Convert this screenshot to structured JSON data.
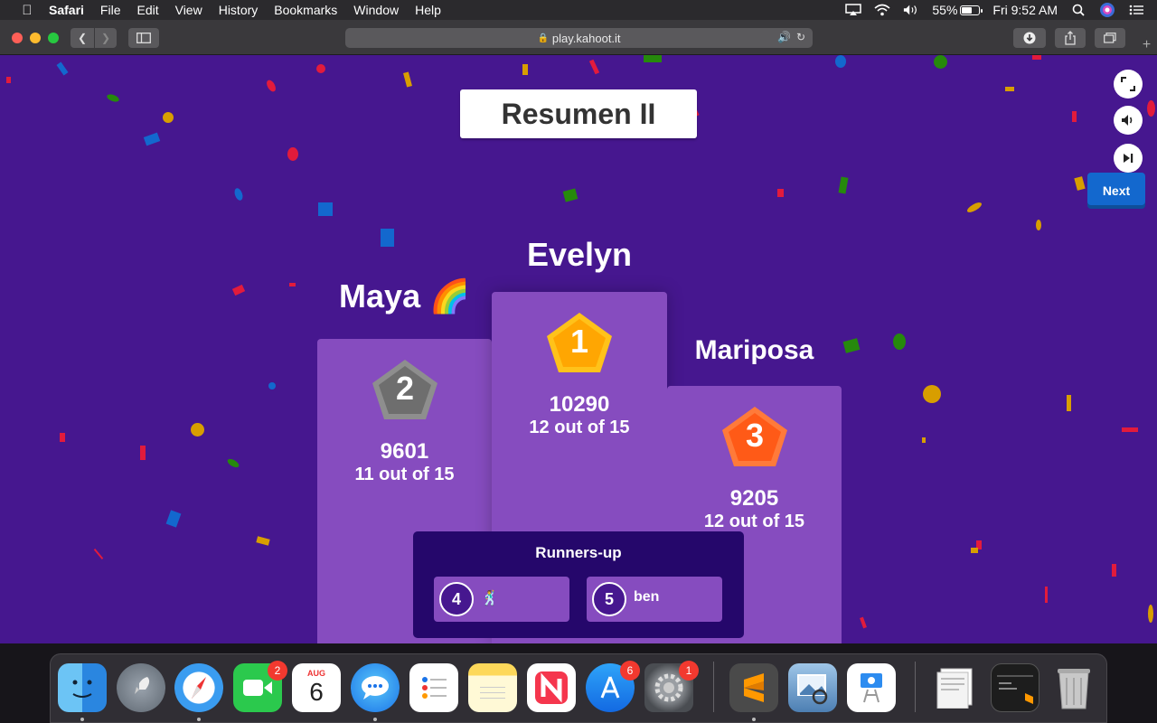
{
  "menubar": {
    "app_name": "Safari",
    "items": [
      "File",
      "Edit",
      "View",
      "History",
      "Bookmarks",
      "Window",
      "Help"
    ],
    "battery_percent": "55%",
    "clock": "Fri 9:52 AM"
  },
  "browser": {
    "url": "play.kahoot.it"
  },
  "quiz": {
    "title": "Resumen II",
    "next_label": "Next",
    "podium": {
      "first": {
        "rank": "1",
        "name": "Evelyn",
        "score": "10290",
        "correct": "12 out of 15"
      },
      "second": {
        "rank": "2",
        "name": "Maya 🌈",
        "score": "9601",
        "correct": "11 out of 15"
      },
      "third": {
        "rank": "3",
        "name": "Mariposa",
        "score": "9205",
        "correct": "12 out of 15"
      }
    },
    "runners_up": {
      "title": "Runners-up",
      "players": [
        {
          "rank": "4",
          "name": "🕺"
        },
        {
          "rank": "5",
          "name": "ben"
        }
      ]
    }
  },
  "dock": {
    "items": [
      {
        "name": "Finder",
        "icon": "finder-icon",
        "badge": ""
      },
      {
        "name": "Launchpad",
        "icon": "rocket-icon",
        "badge": ""
      },
      {
        "name": "Safari",
        "icon": "compass-icon",
        "badge": ""
      },
      {
        "name": "FaceTime",
        "icon": "facetime-icon",
        "badge": "2"
      },
      {
        "name": "Calendar",
        "icon": "calendar-icon",
        "badge": "",
        "month": "AUG",
        "day": "6"
      },
      {
        "name": "Messages",
        "icon": "messages-icon",
        "badge": ""
      },
      {
        "name": "Reminders",
        "icon": "reminders-icon",
        "badge": ""
      },
      {
        "name": "Notes",
        "icon": "notes-icon",
        "badge": ""
      },
      {
        "name": "News",
        "icon": "news-icon",
        "badge": ""
      },
      {
        "name": "App Store",
        "icon": "appstore-icon",
        "badge": "6"
      },
      {
        "name": "System Preferences",
        "icon": "gear-icon",
        "badge": "1"
      },
      {
        "name": "Sublime Text",
        "icon": "sublime-icon",
        "badge": ""
      },
      {
        "name": "Preview",
        "icon": "preview-icon",
        "badge": ""
      },
      {
        "name": "Keynote",
        "icon": "keynote-icon",
        "badge": ""
      },
      {
        "name": "Documents",
        "icon": "documents-icon",
        "badge": ""
      },
      {
        "name": "Terminal",
        "icon": "terminal-icon",
        "badge": ""
      },
      {
        "name": "Trash",
        "icon": "trash-icon",
        "badge": ""
      }
    ]
  },
  "colors": {
    "background": "#46178f",
    "podium": "#864cbf",
    "runners_panel": "#25076b",
    "next_button": "#1368ce",
    "gold": "#ffa602",
    "silver": "#6e6e6e",
    "bronze": "#ff5a17"
  }
}
